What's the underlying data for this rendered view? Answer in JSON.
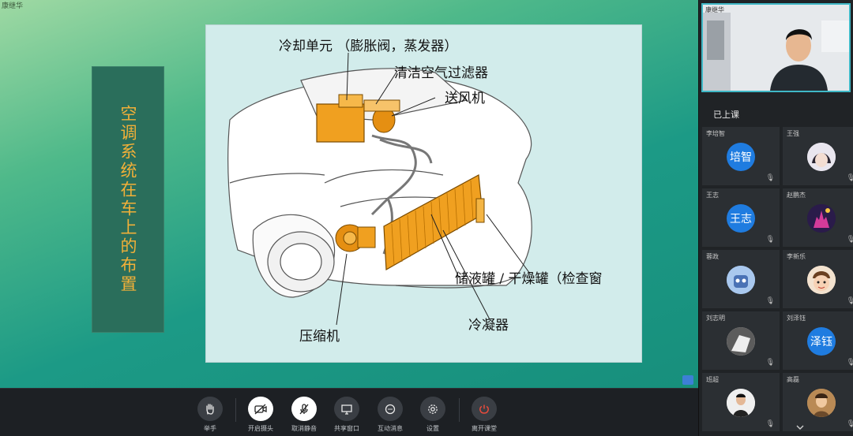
{
  "presenter_tag": "康继华",
  "slide": {
    "side_title": "空调系统在车上的布置",
    "labels": {
      "cooling_unit": "冷却单元 （膨胀阀，蒸发器）",
      "air_filter": "清洁空气过滤器",
      "blower": "送风机",
      "receiver_drier": "储液罐 / 干燥罐（检查窗",
      "condenser": "冷凝器",
      "compressor": "压缩机"
    }
  },
  "teacher": {
    "name": "康继华"
  },
  "participants_section": "已上课",
  "participants": [
    {
      "name": "李培智",
      "avatar_text": "培智",
      "avatar_type": "text"
    },
    {
      "name": "王强",
      "avatar_text": "",
      "avatar_type": "photo-anime"
    },
    {
      "name": "王志",
      "avatar_text": "王志",
      "avatar_type": "text"
    },
    {
      "name": "赵鹏杰",
      "avatar_text": "",
      "avatar_type": "photo-castle"
    },
    {
      "name": "蓉政",
      "avatar_text": "",
      "avatar_type": "photo-robot"
    },
    {
      "name": "李新乐",
      "avatar_text": "",
      "avatar_type": "photo-cartoon"
    },
    {
      "name": "刘志明",
      "avatar_text": "",
      "avatar_type": "photo-hand"
    },
    {
      "name": "刘泽钰",
      "avatar_text": "泽钰",
      "avatar_type": "text"
    },
    {
      "name": "班超",
      "avatar_text": "",
      "avatar_type": "photo-person"
    },
    {
      "name": "高磊",
      "avatar_text": "",
      "avatar_type": "photo-portrait"
    }
  ],
  "toolbar": {
    "raise_hand": "举手",
    "camera": "开启摄头",
    "mic": "取消静音",
    "share": "共享窗口",
    "interact": "互动消息",
    "settings": "设置",
    "leave": "离开课堂"
  },
  "colors": {
    "accent": "#1f7ce0",
    "title_text": "#f2b038",
    "component_orange": "#f0a020",
    "leave_red": "#e84b3c"
  }
}
